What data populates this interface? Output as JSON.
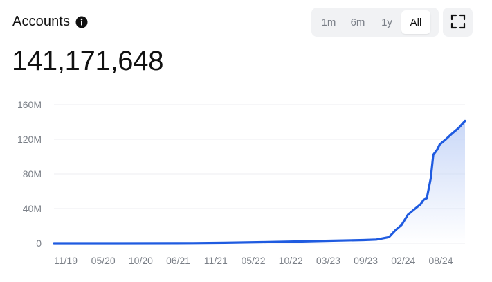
{
  "header": {
    "title": "Accounts",
    "info_icon": "info-icon",
    "value": "141,171,648"
  },
  "range_selector": {
    "options": [
      "1m",
      "6m",
      "1y",
      "All"
    ],
    "selected": "All"
  },
  "expand_icon": "fullscreen-icon",
  "colors": {
    "line": "#1f5be0",
    "fill_top": "#c7d6f7",
    "grid": "#eceef1",
    "tick": "#7a7f87"
  },
  "chart_data": {
    "type": "area",
    "title": "Accounts",
    "xlabel": "",
    "ylabel": "",
    "x_ticks": [
      "11/19",
      "05/20",
      "10/20",
      "06/21",
      "11/21",
      "05/22",
      "10/22",
      "03/23",
      "09/23",
      "02/24",
      "08/24"
    ],
    "y_ticks": [
      0,
      40000000,
      80000000,
      120000000,
      160000000
    ],
    "y_tick_labels": [
      "0",
      "40M",
      "80M",
      "120M",
      "160M"
    ],
    "ylim": [
      0,
      160000000
    ],
    "xlim": [
      "2019-08-01",
      "2025-01-01"
    ],
    "grid": true,
    "legend": "none",
    "series": [
      {
        "x": [
          "2019-08-01",
          "2020-06-01",
          "2021-06-01",
          "2021-11-01",
          "2022-05-01",
          "2022-10-01",
          "2023-03-01",
          "2023-09-01",
          "2023-11-01",
          "2024-01-01",
          "2024-02-01",
          "2024-03-01",
          "2024-04-01",
          "2024-05-01",
          "2024-06-01",
          "2024-06-15",
          "2024-07-01",
          "2024-07-20",
          "2024-08-01",
          "2024-08-20",
          "2024-09-01",
          "2024-10-01",
          "2024-11-01",
          "2024-12-01",
          "2024-12-20",
          "2025-01-01"
        ],
        "values": [
          0,
          0,
          200000,
          500000,
          1200000,
          1900000,
          2700000,
          3600000,
          4200000,
          7000000,
          15000000,
          21000000,
          33000000,
          39000000,
          45000000,
          50000000,
          52000000,
          75000000,
          102000000,
          108000000,
          114000000,
          120000000,
          127000000,
          133000000,
          138000000,
          141171648
        ]
      }
    ]
  }
}
